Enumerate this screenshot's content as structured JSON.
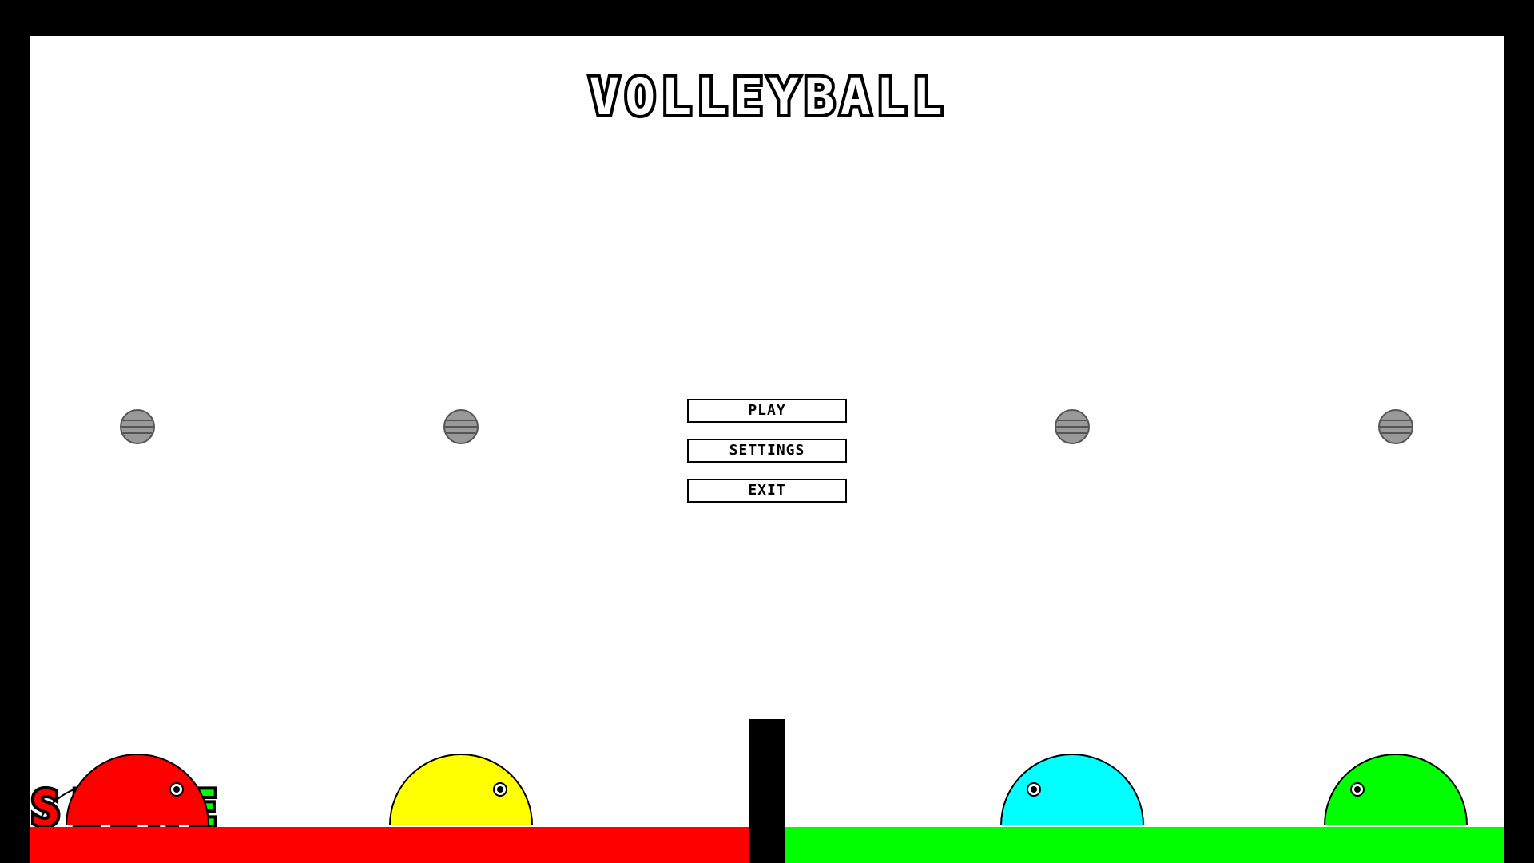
{
  "title": {
    "line1_letters": [
      {
        "char": "S",
        "color": "#ff0000"
      },
      {
        "char": "L",
        "color": "#ffff00"
      },
      {
        "char": "I",
        "color": "#a6a6a6"
      },
      {
        "char": "M",
        "color": "#00ffff"
      },
      {
        "char": "E",
        "color": "#00ff00"
      }
    ],
    "line2": "VOLLEYBALL"
  },
  "menu": {
    "play_label": "PLAY",
    "settings_label": "SETTINGS",
    "exit_label": "EXIT"
  },
  "colors": {
    "background": "#ffffff",
    "frame": "#000000",
    "left_ground": "#ff0000",
    "right_ground": "#00ff00",
    "net": "#000000",
    "ball": "#999999",
    "slime_red": "#ff0000",
    "slime_yellow": "#ffff00",
    "slime_cyan": "#00ffff",
    "slime_green": "#00ff00"
  },
  "slimes": [
    {
      "name": "red-slime",
      "color": "#ff0000",
      "facing": "right"
    },
    {
      "name": "yellow-slime",
      "color": "#ffff00",
      "facing": "right"
    },
    {
      "name": "cyan-slime",
      "color": "#00ffff",
      "facing": "left"
    },
    {
      "name": "green-slime",
      "color": "#00ff00",
      "facing": "left"
    }
  ],
  "balls": [
    "ball-icon",
    "ball-icon",
    "ball-icon",
    "ball-icon"
  ]
}
